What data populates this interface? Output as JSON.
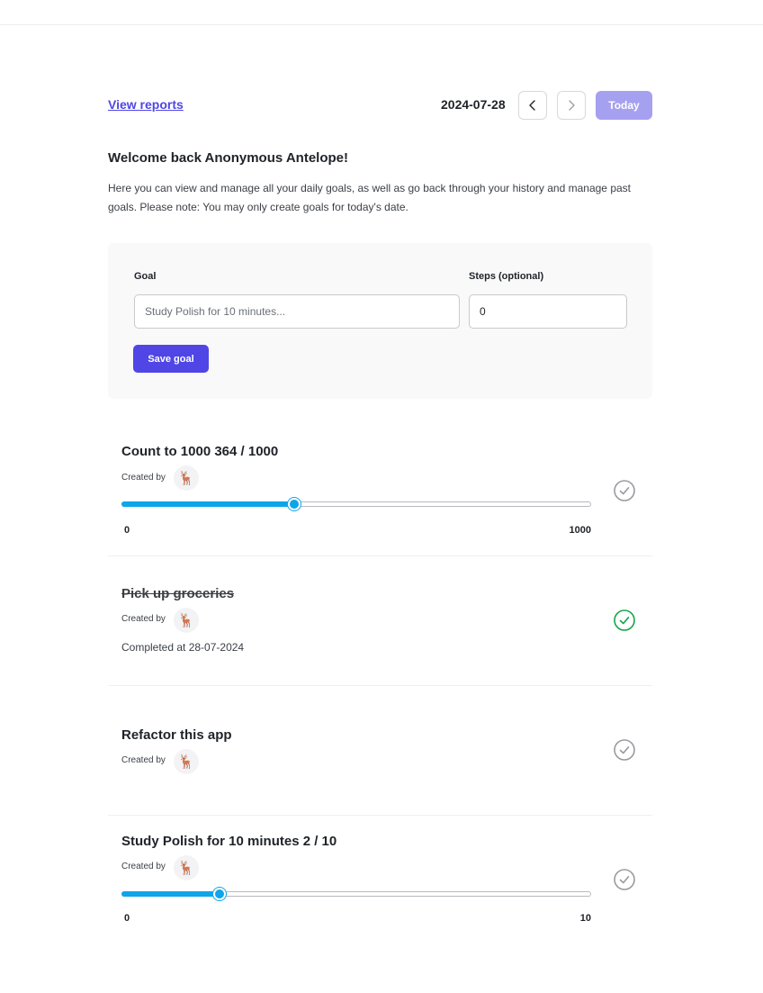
{
  "header": {
    "view_reports": "View reports",
    "date": "2024-07-28",
    "today_label": "Today"
  },
  "welcome": {
    "title": "Welcome back Anonymous Antelope!",
    "text": "Here you can view and manage all your daily goals, as well as go back through your history and manage past goals. Please note: You may only create goals for today's date."
  },
  "form": {
    "goal_label": "Goal",
    "goal_placeholder": "Study Polish for 10 minutes...",
    "steps_label": "Steps (optional)",
    "steps_value": "0",
    "save_label": "Save goal"
  },
  "goals": [
    {
      "title": "Count to 1000 364 / 1000",
      "created_by": "Created by",
      "avatar": "🦌",
      "completed": false,
      "progress": {
        "min": "0",
        "max": "1000",
        "value": 364
      }
    },
    {
      "title": "Pick up groceries",
      "created_by": "Created by",
      "avatar": "🦌",
      "completed": true,
      "completed_at": "Completed at 28-07-2024"
    },
    {
      "title": "Refactor this app",
      "created_by": "Created by",
      "avatar": "🦌",
      "completed": false
    },
    {
      "title": "Study Polish for 10 minutes 2 / 10",
      "created_by": "Created by",
      "avatar": "🦌",
      "completed": false,
      "progress": {
        "min": "0",
        "max": "10",
        "value": 2
      }
    }
  ],
  "colors": {
    "accent": "#4f46e5",
    "slider": "#0ea5e9",
    "check_done": "#16a34a",
    "check_pending": "#9a9aa0"
  }
}
